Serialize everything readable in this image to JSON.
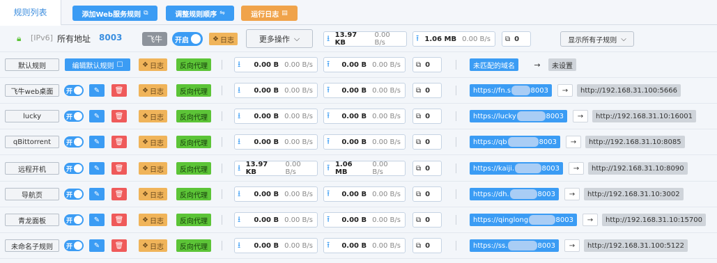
{
  "topbar": {
    "tab_label": "规则列表",
    "add_button": "添加Web服务规则",
    "reorder_button": "调整规则顺序",
    "log_button": "运行日志"
  },
  "global": {
    "ipv6_tag": "[IPv6]",
    "address_label": "所有地址",
    "port": "8003",
    "feiniu_label": "飞牛",
    "enable_label": "开启",
    "log_label": "日志",
    "more_ops": "更多操作",
    "down_bytes": "13.97 KB",
    "down_rate": "0.00 B/s",
    "up_bytes": "1.06 MB",
    "up_rate": "0.00 B/s",
    "connections": "0",
    "show_all": "显示所有子规则"
  },
  "default_rule": {
    "name": "默认规则",
    "edit_label": "编辑默认规则",
    "log_label": "日志",
    "proxy_label": "反向代理",
    "down_bytes": "0.00 B",
    "down_rate": "0.00 B/s",
    "up_bytes": "0.00 B",
    "up_rate": "0.00 B/s",
    "connections": "0",
    "domain": "未匹配的域名",
    "target": "未设置"
  },
  "labels": {
    "toggle_on": "开",
    "log": "日志",
    "proxy": "反向代理"
  },
  "rules": [
    {
      "name": "飞牛web桌面",
      "down_bytes": "0.00 B",
      "down_rate": "0.00 B/s",
      "up_bytes": "0.00 B",
      "up_rate": "0.00 B/s",
      "connections": "0",
      "domain_pre": "https://fn.s",
      "domain_post": "8003",
      "target": "http://192.168.31.100:5666"
    },
    {
      "name": "lucky",
      "down_bytes": "0.00 B",
      "down_rate": "0.00 B/s",
      "up_bytes": "0.00 B",
      "up_rate": "0.00 B/s",
      "connections": "0",
      "domain_pre": "https://lucky",
      "domain_post": "8003",
      "target": "http://192.168.31.10:16001"
    },
    {
      "name": "qBittorrent",
      "down_bytes": "0.00 B",
      "down_rate": "0.00 B/s",
      "up_bytes": "0.00 B",
      "up_rate": "0.00 B/s",
      "connections": "0",
      "domain_pre": "https://qb",
      "domain_post": "8003",
      "target": "http://192.168.31.10:8085"
    },
    {
      "name": "远程开机",
      "down_bytes": "13.97 KB",
      "down_rate": "0.00 B/s",
      "up_bytes": "1.06 MB",
      "up_rate": "0.00 B/s",
      "connections": "0",
      "domain_pre": "https://kaiji.",
      "domain_post": "8003",
      "target": "http://192.168.31.10:8090"
    },
    {
      "name": "导航页",
      "down_bytes": "0.00 B",
      "down_rate": "0.00 B/s",
      "up_bytes": "0.00 B",
      "up_rate": "0.00 B/s",
      "connections": "0",
      "domain_pre": "https://dh.",
      "domain_post": "8003",
      "target": "http://192.168.31.10:3002"
    },
    {
      "name": "青龙面板",
      "down_bytes": "0.00 B",
      "down_rate": "0.00 B/s",
      "up_bytes": "0.00 B",
      "up_rate": "0.00 B/s",
      "connections": "0",
      "domain_pre": "https://qinglong",
      "domain_post": "8003",
      "target": "http://192.168.31.10:15700"
    },
    {
      "name": "未命名子规则",
      "down_bytes": "0.00 B",
      "down_rate": "0.00 B/s",
      "up_bytes": "0.00 B",
      "up_rate": "0.00 B/s",
      "connections": "0",
      "domain_pre": "https://ss.",
      "domain_post": "8003",
      "target": "http://192.168.31.100:5122"
    }
  ]
}
